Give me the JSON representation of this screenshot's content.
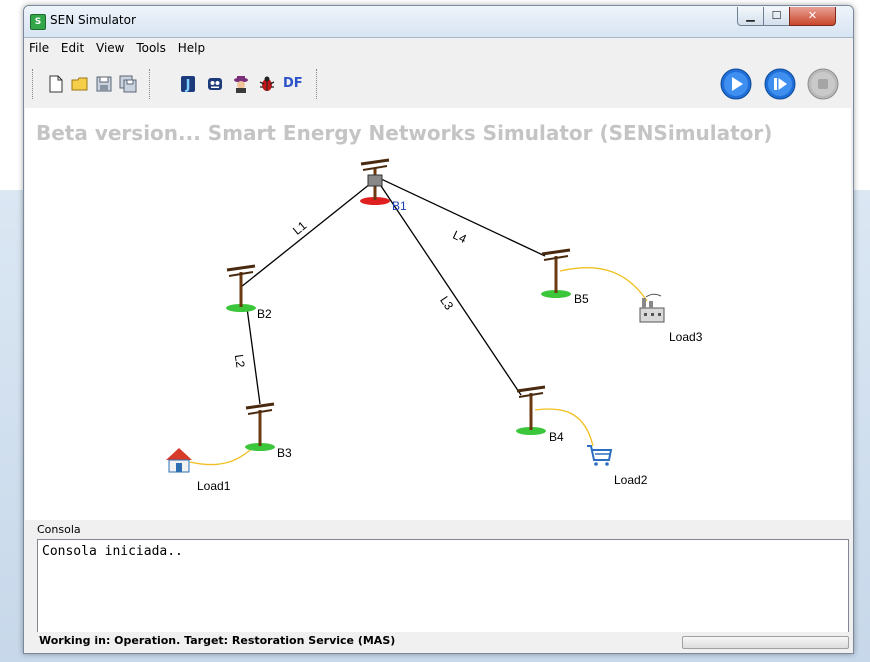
{
  "window": {
    "title": "SEN Simulator"
  },
  "menu": [
    "File",
    "Edit",
    "View",
    "Tools",
    "Help"
  ],
  "toolbar": {
    "icons": [
      "new-file-icon",
      "open-folder-icon",
      "save-icon",
      "save-all-icon",
      "agent-j-icon",
      "robot-icon",
      "spy-icon",
      "bug-icon",
      "df-icon"
    ],
    "df_label": "DF",
    "run_buttons": [
      "play-icon",
      "step-icon",
      "stop-icon"
    ]
  },
  "canvas": {
    "title": "Beta version... Smart Energy Networks Simulator (SENSimulator)",
    "buses": [
      {
        "id": "B1",
        "label": "B1",
        "type": "slack",
        "color": "#e02020"
      },
      {
        "id": "B2",
        "label": "B2",
        "type": "pq",
        "color": "#3cc63c"
      },
      {
        "id": "B3",
        "label": "B3",
        "type": "pq",
        "color": "#3cc63c"
      },
      {
        "id": "B4",
        "label": "B4",
        "type": "pq",
        "color": "#3cc63c"
      },
      {
        "id": "B5",
        "label": "B5",
        "type": "pq",
        "color": "#3cc63c"
      }
    ],
    "lines": [
      {
        "label": "L1",
        "from": "B1",
        "to": "B2"
      },
      {
        "label": "L2",
        "from": "B2",
        "to": "B3"
      },
      {
        "label": "L3",
        "from": "B1",
        "to": "B4"
      },
      {
        "label": "L4",
        "from": "B1",
        "to": "B5"
      }
    ],
    "loads": [
      {
        "label": "Load1",
        "bus": "B3",
        "icon": "house-icon"
      },
      {
        "label": "Load2",
        "bus": "B4",
        "icon": "shopping-cart-icon"
      },
      {
        "label": "Load3",
        "bus": "B5",
        "icon": "factory-icon"
      }
    ],
    "colors": {
      "line": "#000000",
      "load_link": "#f0c020"
    }
  },
  "console": {
    "header": "Consola",
    "text": "Consola iniciada.."
  },
  "status": {
    "text": "Working in: Operation. Target: Restoration Service (MAS)"
  }
}
